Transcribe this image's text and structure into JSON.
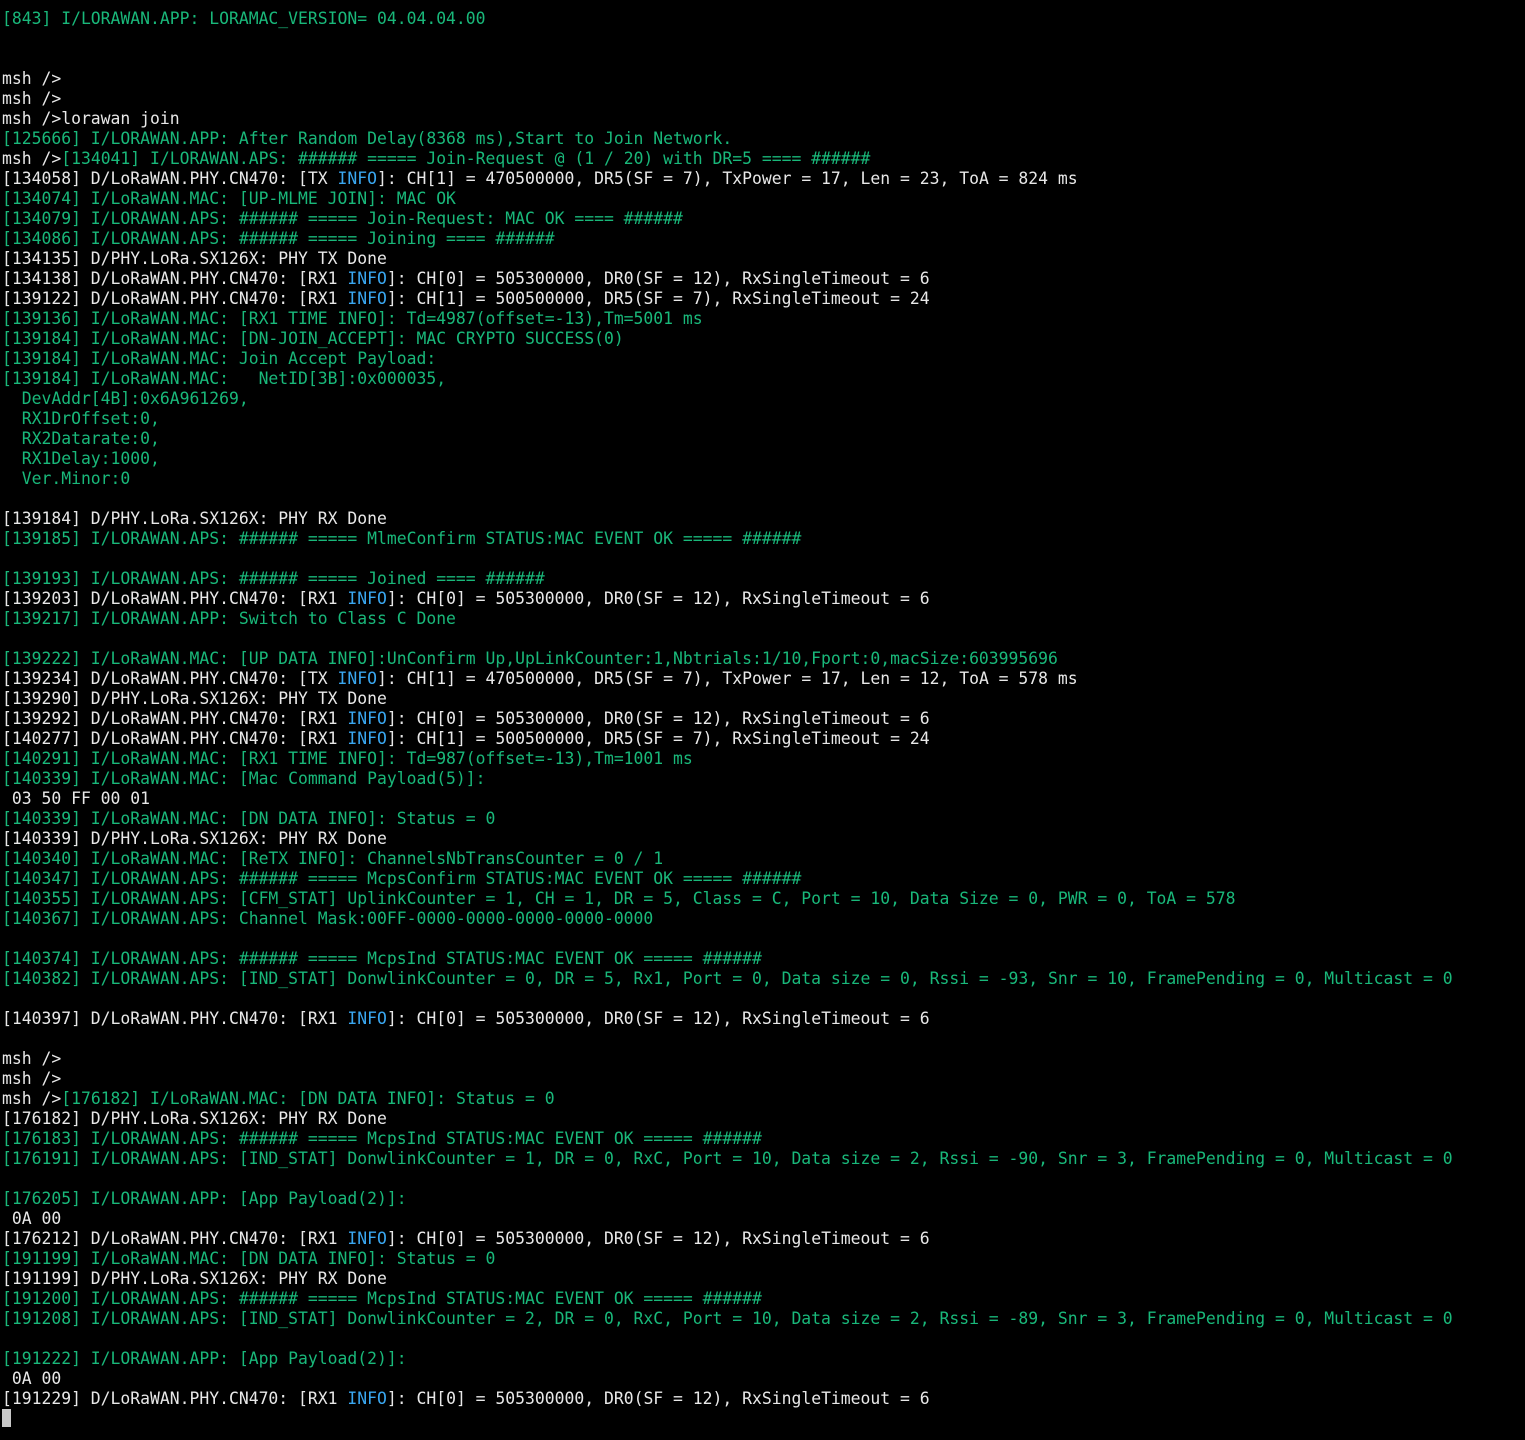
{
  "colors": {
    "background": "#000000",
    "info_log": "#19b87a",
    "debug_log": "#e8e8e8",
    "info_highlight": "#3aa7f0",
    "cursor": "#c8c8c8"
  },
  "lines": [
    [
      [
        "g",
        "[843] I/LORAWAN.APP: LORAMAC_VERSION= 04.04.04.00"
      ]
    ],
    [],
    [],
    [
      [
        "w",
        "msh />"
      ]
    ],
    [
      [
        "w",
        "msh />"
      ]
    ],
    [
      [
        "w",
        "msh />lorawan join"
      ]
    ],
    [
      [
        "g",
        "[125666] I/LORAWAN.APP: After Random Delay(8368 ms),Start to Join Network."
      ]
    ],
    [
      [
        "w",
        "msh />"
      ],
      [
        "g",
        "[134041] I/LORAWAN.APS: ###### ===== Join-Request @ (1 / 20) with DR=5 ==== ######"
      ]
    ],
    [
      [
        "w",
        "[134058] D/LoRaWAN.PHY.CN470: [TX "
      ],
      [
        "b",
        "INFO"
      ],
      [
        "w",
        "]: CH[1] = 470500000, DR5(SF = 7), TxPower = 17, Len = 23, ToA = 824 ms"
      ]
    ],
    [
      [
        "g",
        "[134074] I/LoRaWAN.MAC: [UP-MLME JOIN]: MAC OK"
      ]
    ],
    [
      [
        "g",
        "[134079] I/LORAWAN.APS: ###### ===== Join-Request: MAC OK ==== ######"
      ]
    ],
    [
      [
        "g",
        "[134086] I/LORAWAN.APS: ###### ===== Joining ==== ######"
      ]
    ],
    [
      [
        "w",
        "[134135] D/PHY.LoRa.SX126X: PHY TX Done"
      ]
    ],
    [
      [
        "w",
        "[134138] D/LoRaWAN.PHY.CN470: [RX1 "
      ],
      [
        "b",
        "INFO"
      ],
      [
        "w",
        "]: CH[0] = 505300000, DR0(SF = 12), RxSingleTimeout = 6"
      ]
    ],
    [
      [
        "w",
        "[139122] D/LoRaWAN.PHY.CN470: [RX1 "
      ],
      [
        "b",
        "INFO"
      ],
      [
        "w",
        "]: CH[1] = 500500000, DR5(SF = 7), RxSingleTimeout = 24"
      ]
    ],
    [
      [
        "g",
        "[139136] I/LoRaWAN.MAC: [RX1 TIME INFO]: Td=4987(offset=-13),Tm=5001 ms"
      ]
    ],
    [
      [
        "g",
        "[139184] I/LoRaWAN.MAC: [DN-JOIN_ACCEPT]: MAC CRYPTO SUCCESS(0)"
      ]
    ],
    [
      [
        "g",
        "[139184] I/LoRaWAN.MAC: Join Accept Payload:"
      ]
    ],
    [
      [
        "g",
        "[139184] I/LoRaWAN.MAC:   NetID[3B]:0x000035,"
      ]
    ],
    [
      [
        "g",
        "  DevAddr[4B]:0x6A961269,"
      ]
    ],
    [
      [
        "g",
        "  RX1DrOffset:0,"
      ]
    ],
    [
      [
        "g",
        "  RX2Datarate:0,"
      ]
    ],
    [
      [
        "g",
        "  RX1Delay:1000,"
      ]
    ],
    [
      [
        "g",
        "  Ver.Minor:0"
      ]
    ],
    [],
    [
      [
        "w",
        "[139184] D/PHY.LoRa.SX126X: PHY RX Done"
      ]
    ],
    [
      [
        "g",
        "[139185] I/LORAWAN.APS: ###### ===== MlmeConfirm STATUS:MAC EVENT OK ===== ######"
      ]
    ],
    [],
    [
      [
        "g",
        "[139193] I/LORAWAN.APS: ###### ===== Joined ==== ######"
      ]
    ],
    [
      [
        "w",
        "[139203] D/LoRaWAN.PHY.CN470: [RX1 "
      ],
      [
        "b",
        "INFO"
      ],
      [
        "w",
        "]: CH[0] = 505300000, DR0(SF = 12), RxSingleTimeout = 6"
      ]
    ],
    [
      [
        "g",
        "[139217] I/LORAWAN.APP: Switch to Class C Done"
      ]
    ],
    [],
    [
      [
        "g",
        "[139222] I/LoRaWAN.MAC: [UP DATA INFO]:UnConfirm Up,UpLinkCounter:1,Nbtrials:1/10,Fport:0,macSize:603995696"
      ]
    ],
    [
      [
        "w",
        "[139234] D/LoRaWAN.PHY.CN470: [TX "
      ],
      [
        "b",
        "INFO"
      ],
      [
        "w",
        "]: CH[1] = 470500000, DR5(SF = 7), TxPower = 17, Len = 12, ToA = 578 ms"
      ]
    ],
    [
      [
        "w",
        "[139290] D/PHY.LoRa.SX126X: PHY TX Done"
      ]
    ],
    [
      [
        "w",
        "[139292] D/LoRaWAN.PHY.CN470: [RX1 "
      ],
      [
        "b",
        "INFO"
      ],
      [
        "w",
        "]: CH[0] = 505300000, DR0(SF = 12), RxSingleTimeout = 6"
      ]
    ],
    [
      [
        "w",
        "[140277] D/LoRaWAN.PHY.CN470: [RX1 "
      ],
      [
        "b",
        "INFO"
      ],
      [
        "w",
        "]: CH[1] = 500500000, DR5(SF = 7), RxSingleTimeout = 24"
      ]
    ],
    [
      [
        "g",
        "[140291] I/LoRaWAN.MAC: [RX1 TIME INFO]: Td=987(offset=-13),Tm=1001 ms"
      ]
    ],
    [
      [
        "g",
        "[140339] I/LoRaWAN.MAC: [Mac Command Payload(5)]:"
      ]
    ],
    [
      [
        "w",
        " 03 50 FF 00 01"
      ]
    ],
    [
      [
        "g",
        "[140339] I/LoRaWAN.MAC: [DN DATA INFO]: Status = 0"
      ]
    ],
    [
      [
        "w",
        "[140339] D/PHY.LoRa.SX126X: PHY RX Done"
      ]
    ],
    [
      [
        "g",
        "[140340] I/LoRaWAN.MAC: [ReTX INFO]: ChannelsNbTransCounter = 0 / 1"
      ]
    ],
    [
      [
        "g",
        "[140347] I/LORAWAN.APS: ###### ===== McpsConfirm STATUS:MAC EVENT OK ===== ######"
      ]
    ],
    [
      [
        "g",
        "[140355] I/LORAWAN.APS: [CFM_STAT] UplinkCounter = 1, CH = 1, DR = 5, Class = C, Port = 10, Data Size = 0, PWR = 0, ToA = 578"
      ]
    ],
    [
      [
        "g",
        "[140367] I/LORAWAN.APS: Channel Mask:00FF-0000-0000-0000-0000-0000"
      ]
    ],
    [],
    [
      [
        "g",
        "[140374] I/LORAWAN.APS: ###### ===== McpsInd STATUS:MAC EVENT OK ===== ######"
      ]
    ],
    [
      [
        "g",
        "[140382] I/LORAWAN.APS: [IND_STAT] DonwlinkCounter = 0, DR = 5, Rx1, Port = 0, Data size = 0, Rssi = -93, Snr = 10, FramePending = 0, Multicast = 0"
      ]
    ],
    [],
    [
      [
        "w",
        "[140397] D/LoRaWAN.PHY.CN470: [RX1 "
      ],
      [
        "b",
        "INFO"
      ],
      [
        "w",
        "]: CH[0] = 505300000, DR0(SF = 12), RxSingleTimeout = 6"
      ]
    ],
    [],
    [
      [
        "w",
        "msh />"
      ]
    ],
    [
      [
        "w",
        "msh />"
      ]
    ],
    [
      [
        "w",
        "msh />"
      ],
      [
        "g",
        "[176182] I/LoRaWAN.MAC: [DN DATA INFO]: Status = 0"
      ]
    ],
    [
      [
        "w",
        "[176182] D/PHY.LoRa.SX126X: PHY RX Done"
      ]
    ],
    [
      [
        "g",
        "[176183] I/LORAWAN.APS: ###### ===== McpsInd STATUS:MAC EVENT OK ===== ######"
      ]
    ],
    [
      [
        "g",
        "[176191] I/LORAWAN.APS: [IND_STAT] DonwlinkCounter = 1, DR = 0, RxC, Port = 10, Data size = 2, Rssi = -90, Snr = 3, FramePending = 0, Multicast = 0"
      ]
    ],
    [],
    [
      [
        "g",
        "[176205] I/LORAWAN.APP: [App Payload(2)]:"
      ]
    ],
    [
      [
        "w",
        " 0A 00"
      ]
    ],
    [
      [
        "w",
        "[176212] D/LoRaWAN.PHY.CN470: [RX1 "
      ],
      [
        "b",
        "INFO"
      ],
      [
        "w",
        "]: CH[0] = 505300000, DR0(SF = 12), RxSingleTimeout = 6"
      ]
    ],
    [
      [
        "g",
        "[191199] I/LoRaWAN.MAC: [DN DATA INFO]: Status = 0"
      ]
    ],
    [
      [
        "w",
        "[191199] D/PHY.LoRa.SX126X: PHY RX Done"
      ]
    ],
    [
      [
        "g",
        "[191200] I/LORAWAN.APS: ###### ===== McpsInd STATUS:MAC EVENT OK ===== ######"
      ]
    ],
    [
      [
        "g",
        "[191208] I/LORAWAN.APS: [IND_STAT] DonwlinkCounter = 2, DR = 0, RxC, Port = 10, Data size = 2, Rssi = -89, Snr = 3, FramePending = 0, Multicast = 0"
      ]
    ],
    [],
    [
      [
        "g",
        "[191222] I/LORAWAN.APP: [App Payload(2)]:"
      ]
    ],
    [
      [
        "w",
        " 0A 00"
      ]
    ],
    [
      [
        "w",
        "[191229] D/LoRaWAN.PHY.CN470: [RX1 "
      ],
      [
        "b",
        "INFO"
      ],
      [
        "w",
        "]: CH[0] = 505300000, DR0(SF = 12), RxSingleTimeout = 6"
      ]
    ]
  ]
}
